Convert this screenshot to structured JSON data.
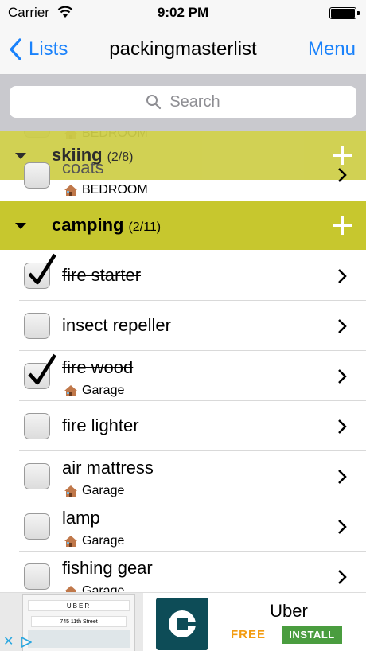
{
  "status_bar": {
    "carrier": "Carrier",
    "time": "9:02 PM"
  },
  "nav": {
    "back_label": "Lists",
    "title": "packingmasterlist",
    "menu_label": "Menu"
  },
  "search": {
    "placeholder": "Search"
  },
  "partial_rows": [
    {
      "name": "coats",
      "location": "BEDROOM"
    }
  ],
  "sections": [
    {
      "name": "skiing",
      "count": "(2/8)",
      "items": []
    },
    {
      "name": "camping",
      "count": "(2/11)",
      "items": [
        {
          "name": "fire starter",
          "checked": true,
          "location": ""
        },
        {
          "name": "insect repeller",
          "checked": false,
          "location": ""
        },
        {
          "name": "fire wood",
          "checked": true,
          "location": "Garage"
        },
        {
          "name": "fire lighter",
          "checked": false,
          "location": ""
        },
        {
          "name": "air mattress",
          "checked": false,
          "location": "Garage"
        },
        {
          "name": "lamp",
          "checked": false,
          "location": "Garage"
        },
        {
          "name": "fishing gear",
          "checked": false,
          "location": "Garage"
        }
      ]
    }
  ],
  "ad": {
    "app_name": "Uber",
    "price": "FREE",
    "install_label": "INSTALL",
    "preview_brand": "UBER",
    "preview_address": "745 11th Street"
  },
  "colors": {
    "tint": "#1a82fb",
    "section_bg": "#c7c72e",
    "search_bg": "#c9c9ce",
    "install_bg": "#4a9d3f",
    "free_text": "#f39c12"
  }
}
